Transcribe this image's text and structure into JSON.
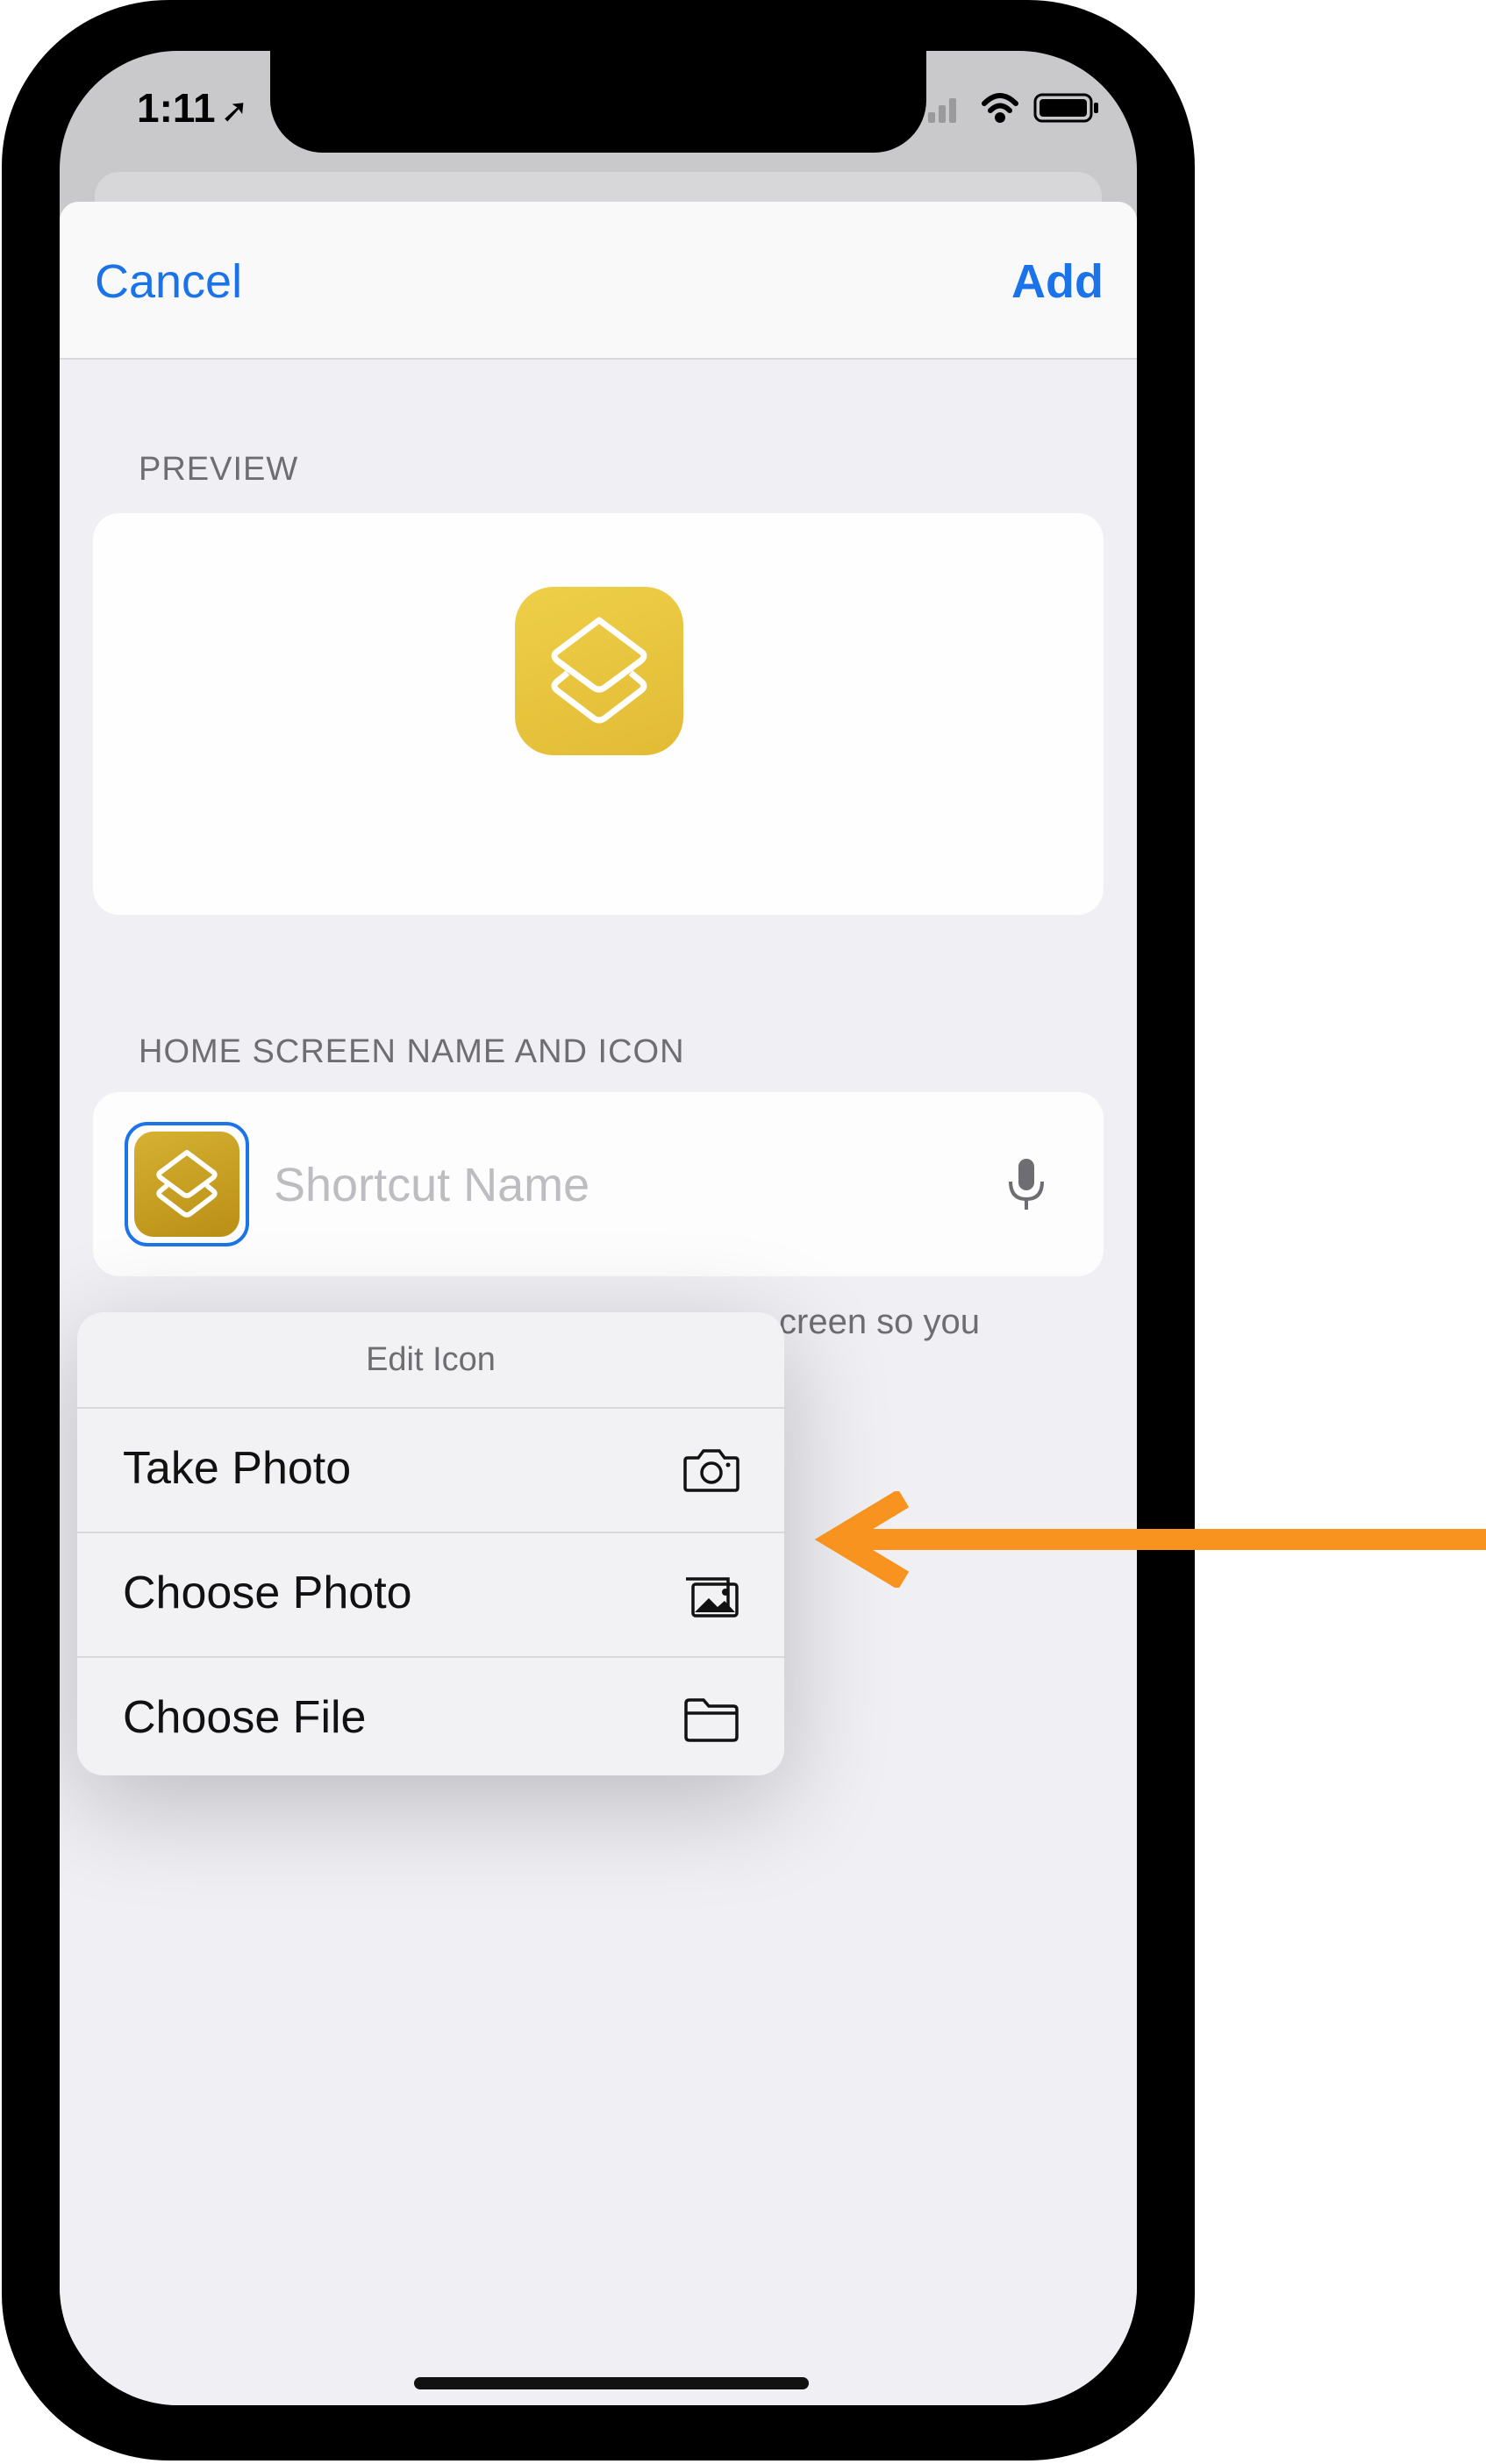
{
  "status_bar": {
    "time": "1:11"
  },
  "nav": {
    "cancel_label": "Cancel",
    "add_label": "Add"
  },
  "preview": {
    "section_label": "PREVIEW"
  },
  "home_screen": {
    "section_label": "HOME SCREEN NAME AND ICON",
    "name_placeholder": "Shortcut Name",
    "footnote_partial": "creen so you"
  },
  "edit_icon_menu": {
    "title": "Edit Icon",
    "items": [
      {
        "label": "Take Photo",
        "icon": "camera-icon"
      },
      {
        "label": "Choose Photo",
        "icon": "photo-library-icon"
      },
      {
        "label": "Choose File",
        "icon": "folder-icon"
      }
    ]
  },
  "colors": {
    "accent": "#1a73e8",
    "arrow": "#f7931e",
    "app_icon": "#e9c640"
  }
}
